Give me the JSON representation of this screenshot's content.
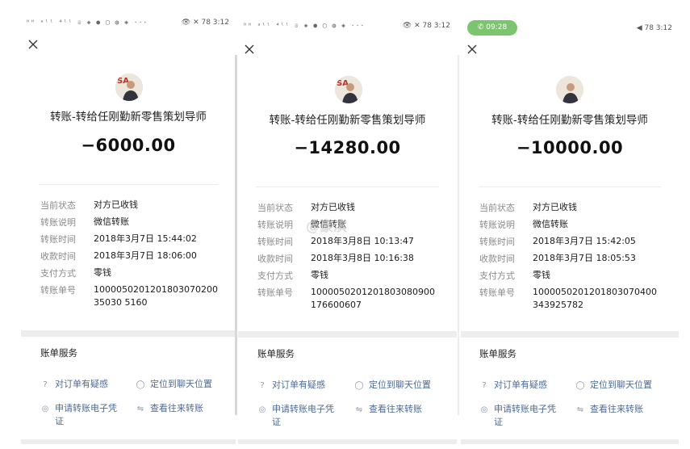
{
  "panels": [
    {
      "status_left": "ᵸᵸ ᵃˡˡ ⁴ˡˡ ☏ ◈ ● ▢ ◍ ◈ ···",
      "status_right": "👁 ✕ 78 3:12",
      "title": "转账-转给任刚勤新零售策划导师",
      "amount": "−6000.00",
      "details": [
        {
          "label": "当前状态",
          "value": "对方已收钱"
        },
        {
          "label": "转账说明",
          "value": "微信转账"
        },
        {
          "label": "转账时间",
          "value": "2018年3月7日 15:44:02"
        },
        {
          "label": "收款时间",
          "value": "2018年3月7日 18:06:00"
        },
        {
          "label": "支付方式",
          "value": "零钱"
        },
        {
          "label": "转账单号",
          "value": "100005020120180307020035030 5160"
        }
      ],
      "service_title": "账单服务",
      "links": [
        "对订单有疑感",
        "定位到聊天位置",
        "申请转账电子凭证",
        "查看往来转账"
      ]
    },
    {
      "status_left": "ᵸᵸ ᵃˡˡ ⁴ˡˡ ☏ ◈ ● ▢ ◍ ◈ ···",
      "status_right": "👁 ✕ 78 3:12",
      "title": "转账-转给任刚勤新零售策划导师",
      "amount": "−14280.00",
      "details": [
        {
          "label": "当前状态",
          "value": "对方已收钱"
        },
        {
          "label": "转账说明",
          "value": "微信转账"
        },
        {
          "label": "转账时间",
          "value": "2018年3月8日 10:13:47"
        },
        {
          "label": "收款时间",
          "value": "2018年3月8日 10:16:38"
        },
        {
          "label": "支付方式",
          "value": "零钱"
        },
        {
          "label": "转账单号",
          "value": "1000050201201803080900176600607"
        }
      ],
      "service_title": "账单服务",
      "links": [
        "对订单有疑感",
        "定位到聊天位置",
        "申请转账电子凭证",
        "查看往来转账"
      ],
      "watermark": "@豪滨"
    },
    {
      "call_time": "09:28",
      "status_right": "◀ 78 3:12",
      "title": "转账-转给任刚勤新零售策划导师",
      "amount": "−10000.00",
      "details": [
        {
          "label": "当前状态",
          "value": "对方已收钱"
        },
        {
          "label": "转账说明",
          "value": "微信转账"
        },
        {
          "label": "转账时间",
          "value": "2018年3月7日 15:42:05"
        },
        {
          "label": "收款时间",
          "value": "2018年3月7日 18:05:53"
        },
        {
          "label": "支付方式",
          "value": "零钱"
        },
        {
          "label": "转账单号",
          "value": "1000050201201803070400343925782"
        }
      ],
      "service_title": "账单服务",
      "links": [
        "对订单有疑感",
        "定位到聊天位置",
        "申请转账电子凭证",
        "查看往来转账"
      ]
    }
  ],
  "colors": {
    "link": "#4d6b96",
    "call_pill": "#7cc46d",
    "label": "#8a8a8a"
  },
  "icons": {
    "close": "close-icon",
    "question": "question-circle-icon",
    "chat": "chat-bubble-icon",
    "receipt": "receipt-icon",
    "transfer": "transfer-arrows-icon"
  }
}
